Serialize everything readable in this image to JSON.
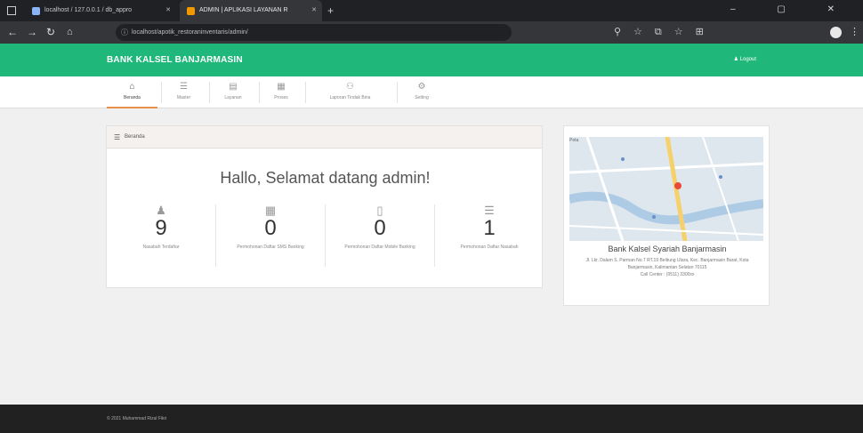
{
  "browser": {
    "tabs": [
      {
        "title": "localhost / 127.0.0.1 / db_appro"
      },
      {
        "title": "ADMIN | APLIKASI LAYANAN R"
      }
    ],
    "url": "localhost/apotik_restoraninventaris/admin/",
    "new_tab": "+",
    "window_controls": "– ▢ ✕"
  },
  "app": {
    "brand": "BANK KALSEL BANJARMASIN",
    "logout": "Logout",
    "accent_color": "#1fb77a",
    "menu": [
      {
        "label": "Beranda",
        "icon": "home-icon",
        "active": true
      },
      {
        "label": "Master",
        "icon": "list-icon"
      },
      {
        "label": "Layanan",
        "icon": "calendar-icon"
      },
      {
        "label": "Proses",
        "icon": "table-icon"
      },
      {
        "label": "Laporan Tindak Bina",
        "icon": "users-icon"
      },
      {
        "label": "Setting",
        "icon": "gear-icon"
      }
    ]
  },
  "panel": {
    "header": "Beranda",
    "greeting": "Hallo, Selamat datang admin!",
    "stats": [
      {
        "value": "9",
        "label": "Nasabah Terdaftar",
        "icon": "user-icon"
      },
      {
        "value": "0",
        "label": "Permohonan Daftar SMS Banking",
        "icon": "building-icon"
      },
      {
        "value": "0",
        "label": "Permohonan Daftar Mobile Banking",
        "icon": "mobile-icon"
      },
      {
        "value": "1",
        "label": "Permohonan Daftar Nasabah",
        "icon": "list-icon"
      }
    ]
  },
  "mapcard": {
    "map_label": "Peta",
    "name": "Bank Kalsel Syariah Banjarmasin",
    "address": "Jl. Lkr. Dalam S. Parman No.7 RT.19 Belitung Utara, Kec. Banjarmasin Barat, Kota Banjarmasin, Kalimantan Selatan 70115",
    "phone": "Call Center : (0511) 3300xx"
  },
  "footer": {
    "text": "© 2021 Muhammad Rizal Fikri"
  }
}
